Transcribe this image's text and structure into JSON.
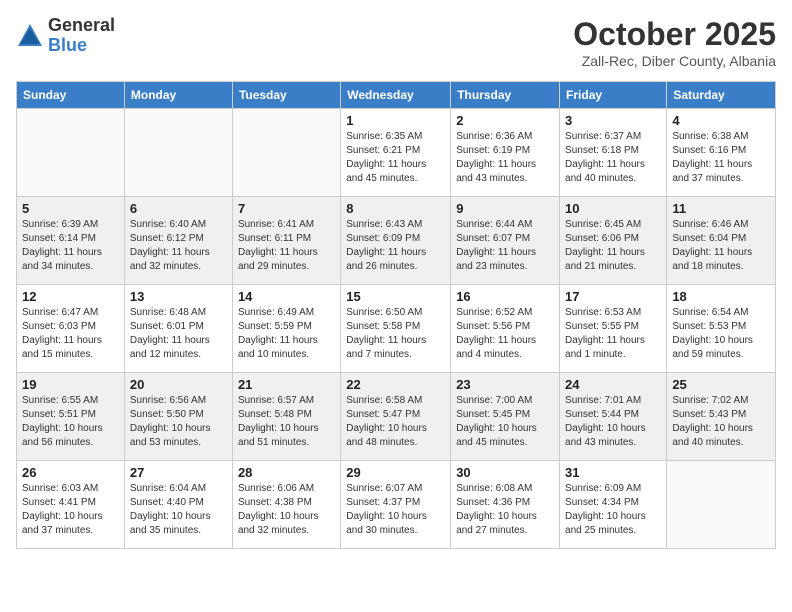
{
  "logo": {
    "general": "General",
    "blue": "Blue"
  },
  "title": "October 2025",
  "location": "Zall-Rec, Diber County, Albania",
  "days_of_week": [
    "Sunday",
    "Monday",
    "Tuesday",
    "Wednesday",
    "Thursday",
    "Friday",
    "Saturday"
  ],
  "weeks": [
    [
      {
        "day": "",
        "info": ""
      },
      {
        "day": "",
        "info": ""
      },
      {
        "day": "",
        "info": ""
      },
      {
        "day": "1",
        "info": "Sunrise: 6:35 AM\nSunset: 6:21 PM\nDaylight: 11 hours\nand 45 minutes."
      },
      {
        "day": "2",
        "info": "Sunrise: 6:36 AM\nSunset: 6:19 PM\nDaylight: 11 hours\nand 43 minutes."
      },
      {
        "day": "3",
        "info": "Sunrise: 6:37 AM\nSunset: 6:18 PM\nDaylight: 11 hours\nand 40 minutes."
      },
      {
        "day": "4",
        "info": "Sunrise: 6:38 AM\nSunset: 6:16 PM\nDaylight: 11 hours\nand 37 minutes."
      }
    ],
    [
      {
        "day": "5",
        "info": "Sunrise: 6:39 AM\nSunset: 6:14 PM\nDaylight: 11 hours\nand 34 minutes."
      },
      {
        "day": "6",
        "info": "Sunrise: 6:40 AM\nSunset: 6:12 PM\nDaylight: 11 hours\nand 32 minutes."
      },
      {
        "day": "7",
        "info": "Sunrise: 6:41 AM\nSunset: 6:11 PM\nDaylight: 11 hours\nand 29 minutes."
      },
      {
        "day": "8",
        "info": "Sunrise: 6:43 AM\nSunset: 6:09 PM\nDaylight: 11 hours\nand 26 minutes."
      },
      {
        "day": "9",
        "info": "Sunrise: 6:44 AM\nSunset: 6:07 PM\nDaylight: 11 hours\nand 23 minutes."
      },
      {
        "day": "10",
        "info": "Sunrise: 6:45 AM\nSunset: 6:06 PM\nDaylight: 11 hours\nand 21 minutes."
      },
      {
        "day": "11",
        "info": "Sunrise: 6:46 AM\nSunset: 6:04 PM\nDaylight: 11 hours\nand 18 minutes."
      }
    ],
    [
      {
        "day": "12",
        "info": "Sunrise: 6:47 AM\nSunset: 6:03 PM\nDaylight: 11 hours\nand 15 minutes."
      },
      {
        "day": "13",
        "info": "Sunrise: 6:48 AM\nSunset: 6:01 PM\nDaylight: 11 hours\nand 12 minutes."
      },
      {
        "day": "14",
        "info": "Sunrise: 6:49 AM\nSunset: 5:59 PM\nDaylight: 11 hours\nand 10 minutes."
      },
      {
        "day": "15",
        "info": "Sunrise: 6:50 AM\nSunset: 5:58 PM\nDaylight: 11 hours\nand 7 minutes."
      },
      {
        "day": "16",
        "info": "Sunrise: 6:52 AM\nSunset: 5:56 PM\nDaylight: 11 hours\nand 4 minutes."
      },
      {
        "day": "17",
        "info": "Sunrise: 6:53 AM\nSunset: 5:55 PM\nDaylight: 11 hours\nand 1 minute."
      },
      {
        "day": "18",
        "info": "Sunrise: 6:54 AM\nSunset: 5:53 PM\nDaylight: 10 hours\nand 59 minutes."
      }
    ],
    [
      {
        "day": "19",
        "info": "Sunrise: 6:55 AM\nSunset: 5:51 PM\nDaylight: 10 hours\nand 56 minutes."
      },
      {
        "day": "20",
        "info": "Sunrise: 6:56 AM\nSunset: 5:50 PM\nDaylight: 10 hours\nand 53 minutes."
      },
      {
        "day": "21",
        "info": "Sunrise: 6:57 AM\nSunset: 5:48 PM\nDaylight: 10 hours\nand 51 minutes."
      },
      {
        "day": "22",
        "info": "Sunrise: 6:58 AM\nSunset: 5:47 PM\nDaylight: 10 hours\nand 48 minutes."
      },
      {
        "day": "23",
        "info": "Sunrise: 7:00 AM\nSunset: 5:45 PM\nDaylight: 10 hours\nand 45 minutes."
      },
      {
        "day": "24",
        "info": "Sunrise: 7:01 AM\nSunset: 5:44 PM\nDaylight: 10 hours\nand 43 minutes."
      },
      {
        "day": "25",
        "info": "Sunrise: 7:02 AM\nSunset: 5:43 PM\nDaylight: 10 hours\nand 40 minutes."
      }
    ],
    [
      {
        "day": "26",
        "info": "Sunrise: 6:03 AM\nSunset: 4:41 PM\nDaylight: 10 hours\nand 37 minutes."
      },
      {
        "day": "27",
        "info": "Sunrise: 6:04 AM\nSunset: 4:40 PM\nDaylight: 10 hours\nand 35 minutes."
      },
      {
        "day": "28",
        "info": "Sunrise: 6:06 AM\nSunset: 4:38 PM\nDaylight: 10 hours\nand 32 minutes."
      },
      {
        "day": "29",
        "info": "Sunrise: 6:07 AM\nSunset: 4:37 PM\nDaylight: 10 hours\nand 30 minutes."
      },
      {
        "day": "30",
        "info": "Sunrise: 6:08 AM\nSunset: 4:36 PM\nDaylight: 10 hours\nand 27 minutes."
      },
      {
        "day": "31",
        "info": "Sunrise: 6:09 AM\nSunset: 4:34 PM\nDaylight: 10 hours\nand 25 minutes."
      },
      {
        "day": "",
        "info": ""
      }
    ]
  ]
}
